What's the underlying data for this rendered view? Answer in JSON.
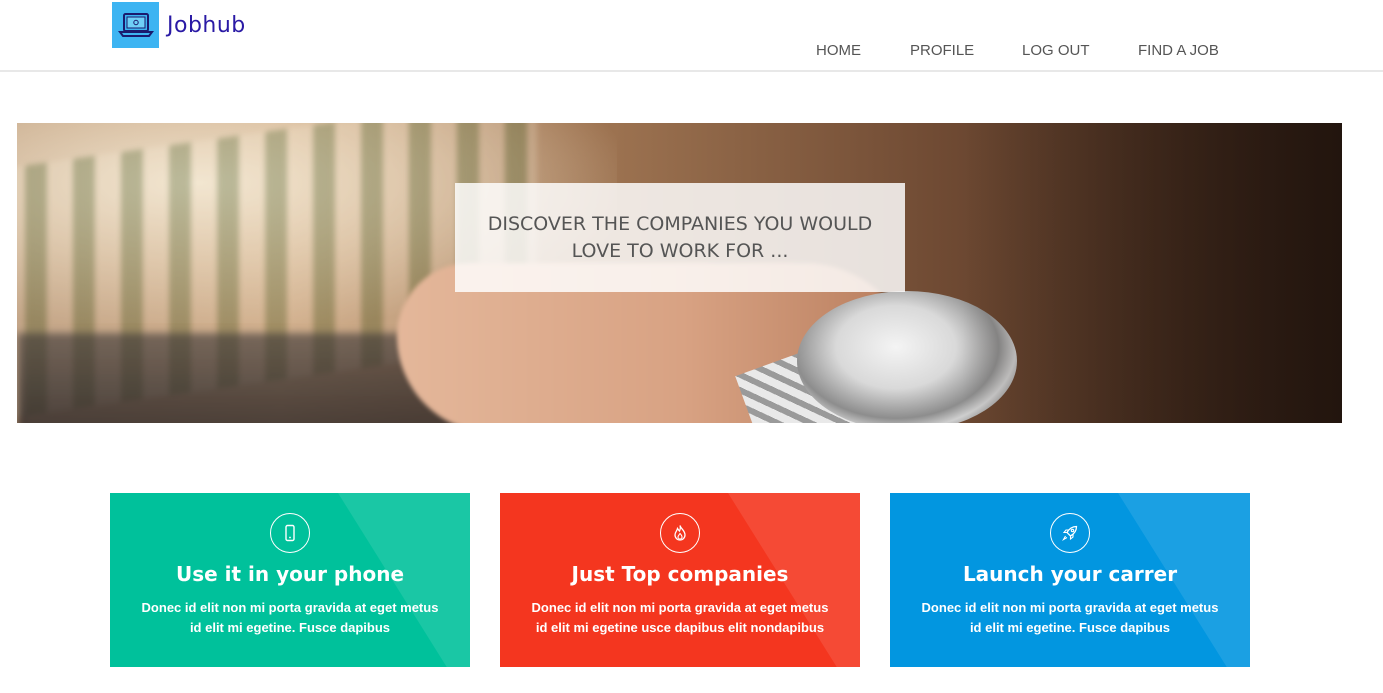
{
  "brand": {
    "name": "Jobhub",
    "logo_color": "#3db4f2",
    "name_color": "#2a1aa5"
  },
  "nav": {
    "home": "HOME",
    "profile": "PROFILE",
    "logout": "LOG OUT",
    "find_job": "FIND A JOB"
  },
  "hero": {
    "headline": "DISCOVER THE COMPANIES YOU WOULD LOVE TO WORK FOR ..."
  },
  "cards": [
    {
      "icon": "phone-icon",
      "title": "Use it in your phone",
      "body": "Donec id elit non mi porta gravida at eget metus id elit mi egetine. Fusce dapibus",
      "color": "#00c19b"
    },
    {
      "icon": "fire-icon",
      "title": "Just Top companies",
      "body": "Donec id elit non mi porta gravida at eget metus id elit mi egetine usce dapibus elit nondapibus",
      "color": "#f4361f"
    },
    {
      "icon": "rocket-icon",
      "title": "Launch your carrer",
      "body": "Donec id elit non mi porta gravida at eget metus id elit mi egetine. Fusce dapibus",
      "color": "#0296e0"
    }
  ]
}
